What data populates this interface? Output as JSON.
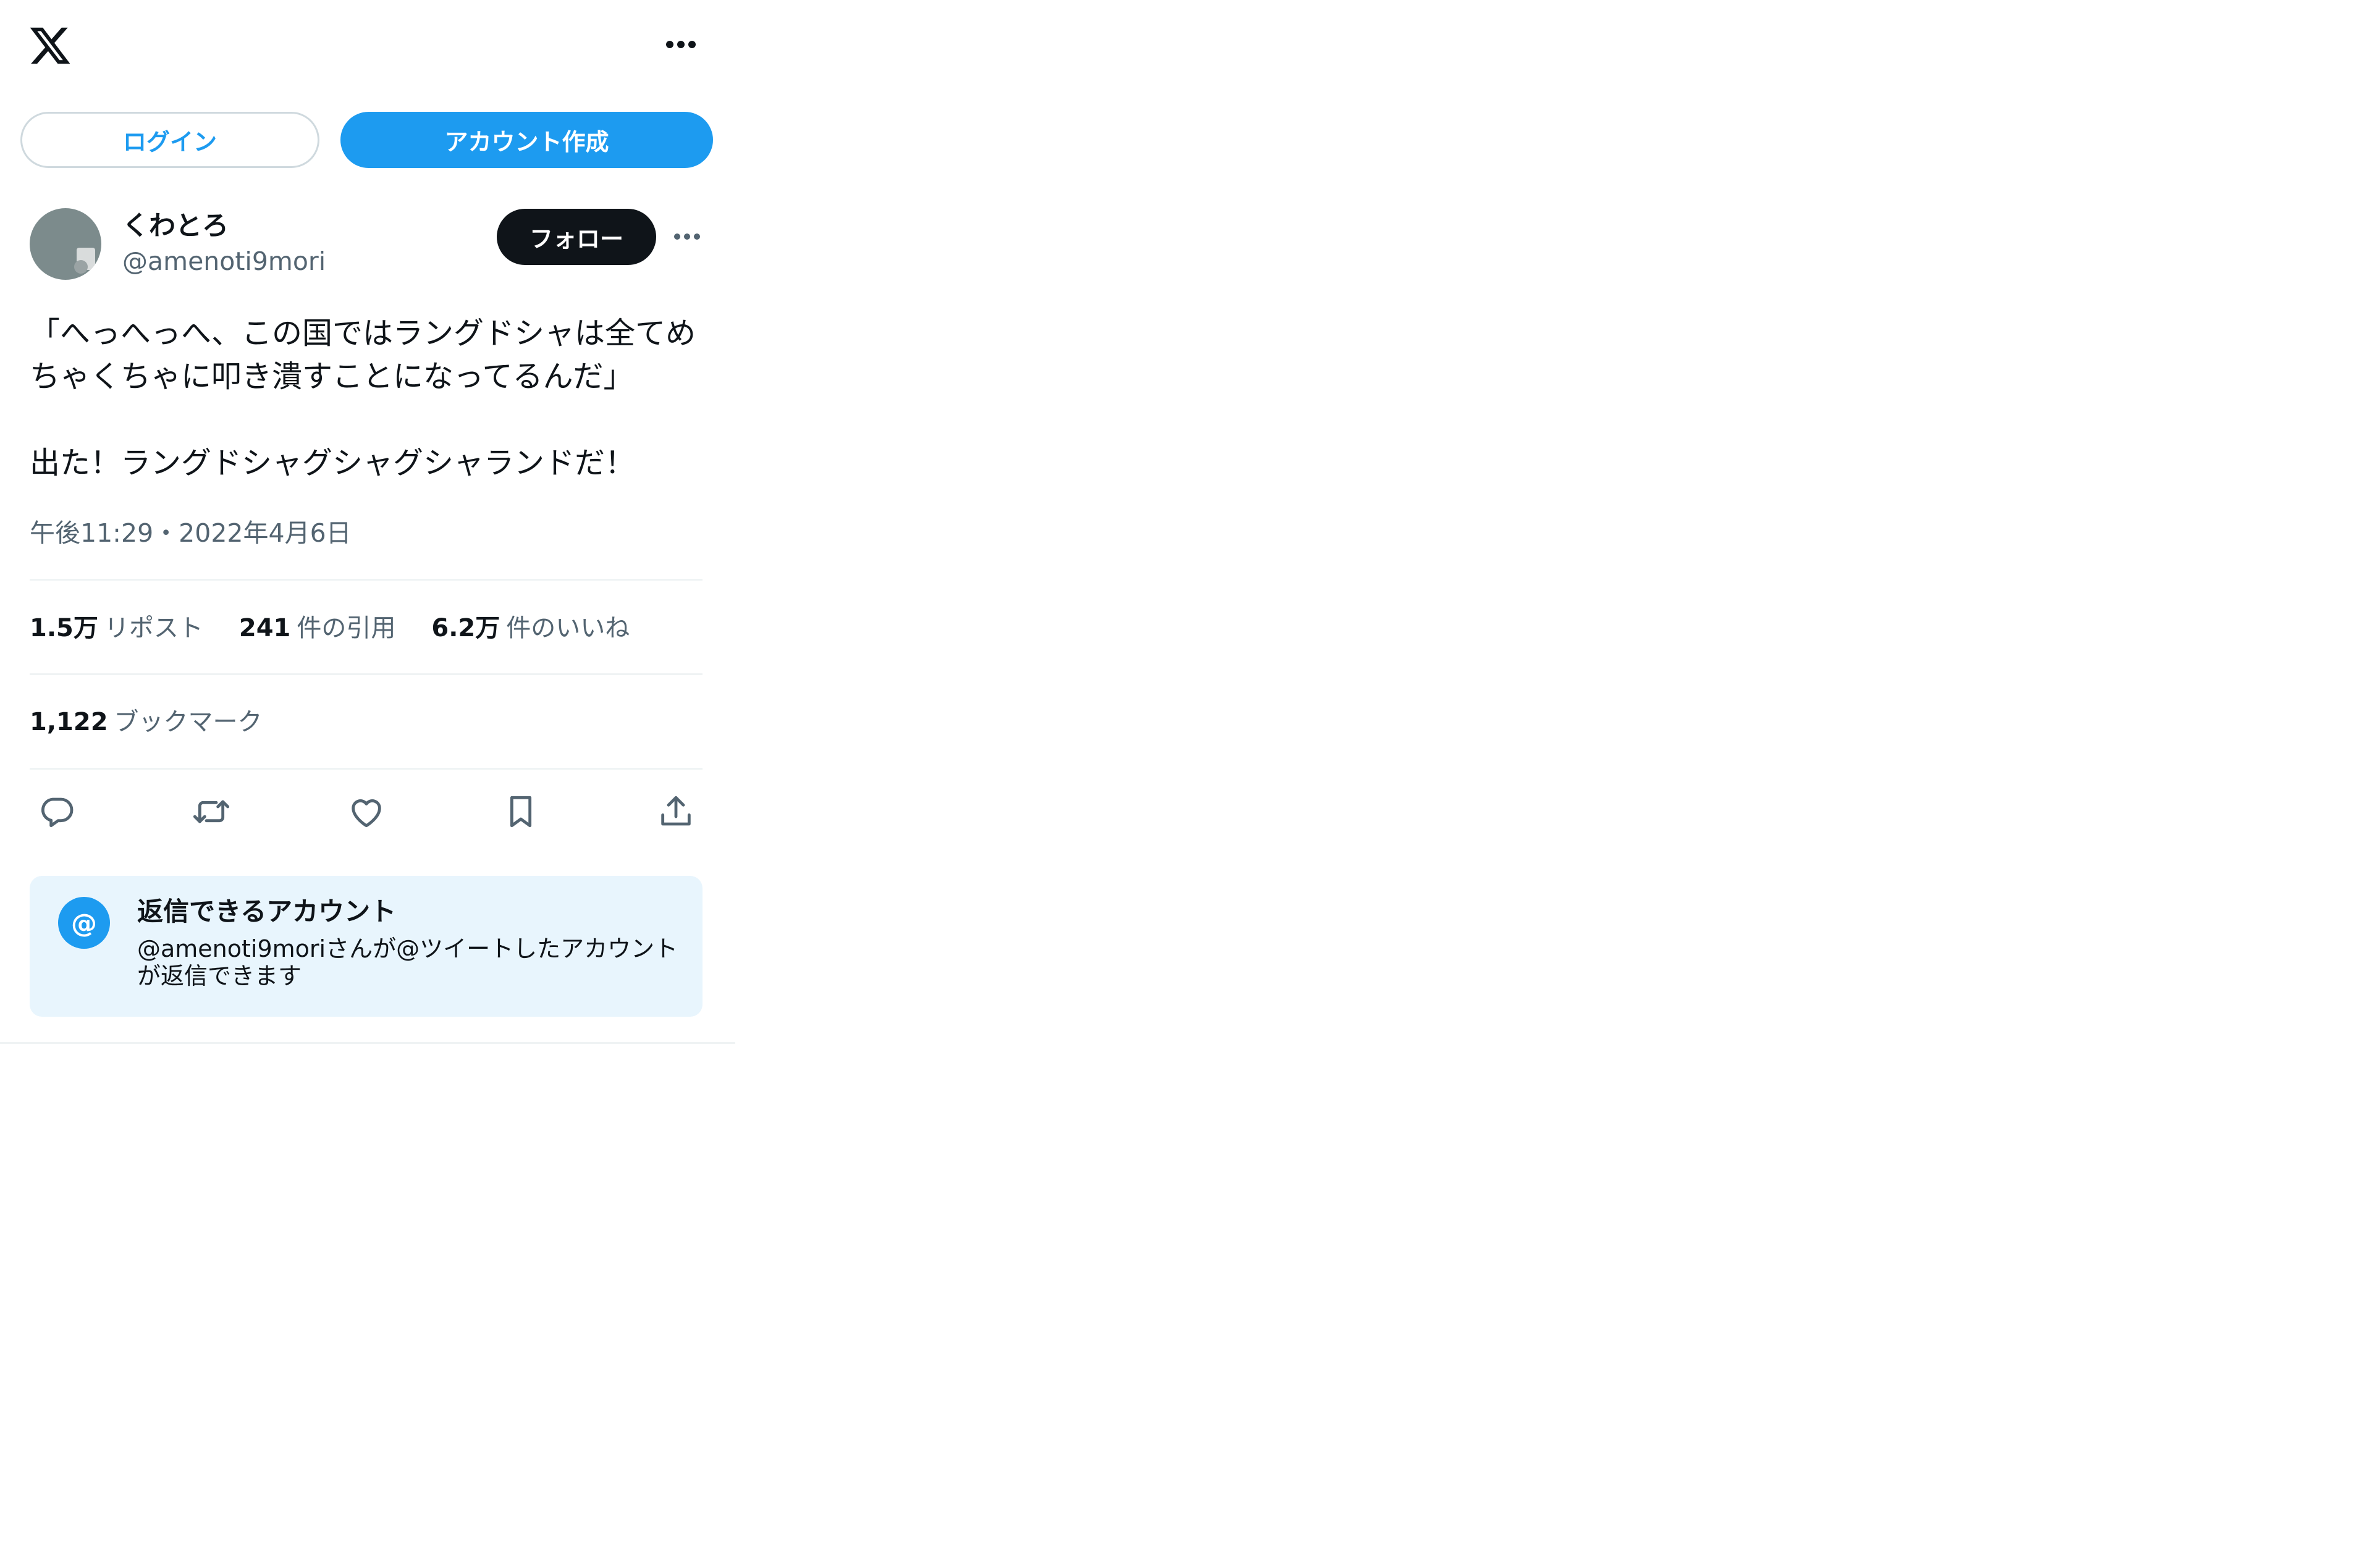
{
  "header": {
    "logo_icon": "x-logo-icon",
    "more_icon": "more-horizontal-icon"
  },
  "auth": {
    "login_label": "ログイン",
    "signup_label": "アカウント作成"
  },
  "author": {
    "display_name": "くわとろ",
    "handle": "@amenoti9mori",
    "follow_label": "フォロー",
    "more_icon": "more-horizontal-icon"
  },
  "tweet": {
    "text": "「へっへっへ、この国ではラングドシャは全てめちゃくちゃに叩き潰すことになってるんだ」\n\n出た！ラングドシャグシャグシャランドだ！",
    "timestamp": "午後11:29・2022年4月6日"
  },
  "stats": {
    "reposts_count": "1.5万",
    "reposts_label": "リポスト",
    "quotes_count": "241",
    "quotes_label": "件の引用",
    "likes_count": "6.2万",
    "likes_label": "件のいいね",
    "bookmarks_count": "1,122",
    "bookmarks_label": "ブックマーク"
  },
  "actions": {
    "reply_icon": "reply-icon",
    "repost_icon": "repost-icon",
    "like_icon": "heart-icon",
    "bookmark_icon": "bookmark-icon",
    "share_icon": "share-icon"
  },
  "reply_restriction": {
    "icon_symbol": "@",
    "title": "返信できるアカウント",
    "description": "@amenoti9moriさんが@ツイートしたアカウントが返信できます"
  },
  "colors": {
    "accent": "#1d9bf0",
    "text_primary": "#0f1419",
    "text_secondary": "#536471",
    "divider": "#eff3f4",
    "info_background": "#e8f5fd"
  }
}
